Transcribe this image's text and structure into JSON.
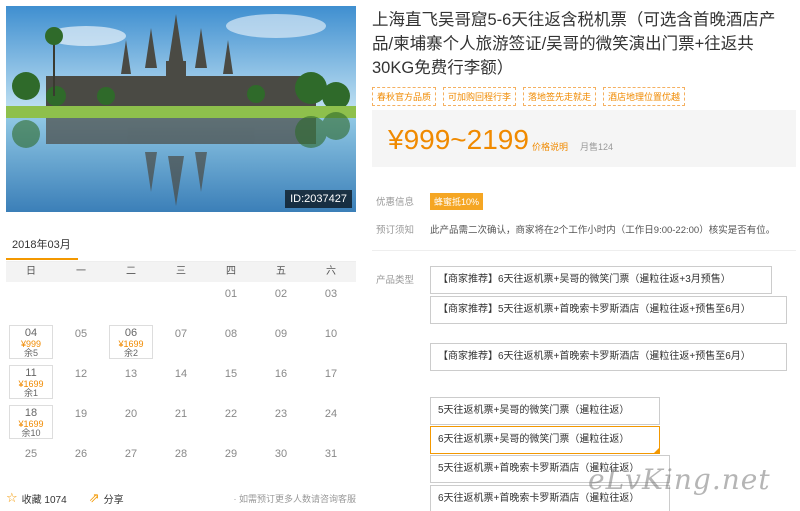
{
  "hero": {
    "id_badge": "ID:2037427"
  },
  "calendar": {
    "month_tab": "2018年03月",
    "weekdays": [
      "日",
      "一",
      "二",
      "三",
      "四",
      "五",
      "六"
    ],
    "days": [
      {
        "d": ""
      },
      {
        "d": ""
      },
      {
        "d": ""
      },
      {
        "d": ""
      },
      {
        "d": "01"
      },
      {
        "d": "02"
      },
      {
        "d": "03"
      },
      {
        "d": "04",
        "price": "¥999",
        "stock": "余5"
      },
      {
        "d": "05"
      },
      {
        "d": "06",
        "price": "¥1699",
        "stock": "余2"
      },
      {
        "d": "07"
      },
      {
        "d": "08"
      },
      {
        "d": "09"
      },
      {
        "d": "10"
      },
      {
        "d": "11",
        "price": "¥1699",
        "stock": "余1"
      },
      {
        "d": "12"
      },
      {
        "d": "13"
      },
      {
        "d": "14"
      },
      {
        "d": "15"
      },
      {
        "d": "16"
      },
      {
        "d": "17"
      },
      {
        "d": "18",
        "price": "¥1699",
        "stock": "余10"
      },
      {
        "d": "19"
      },
      {
        "d": "20"
      },
      {
        "d": "21"
      },
      {
        "d": "22"
      },
      {
        "d": "23"
      },
      {
        "d": "24"
      },
      {
        "d": "25"
      },
      {
        "d": "26"
      },
      {
        "d": "27"
      },
      {
        "d": "28"
      },
      {
        "d": "29"
      },
      {
        "d": "30"
      },
      {
        "d": "31"
      }
    ]
  },
  "bottom": {
    "favorite": "收藏 1074",
    "share": "分享",
    "tip": "· 如需预订更多人数请咨询客服"
  },
  "product": {
    "title": "上海直飞吴哥窟5-6天往返含税机票（可选含首晚酒店产品/柬埔寨个人旅游签证/吴哥的微笑演出门票+往返共30KG免费行李额）",
    "tags": [
      "春秋官方品质",
      "可加购回程行李",
      "落地签先走就走",
      "酒店地理位置优越"
    ],
    "price": "¥999~2199",
    "price_link": "价格说明",
    "sales": "月售124"
  },
  "info": {
    "promo_label": "优惠信息",
    "promo_badge": "蜂蜜抵10%",
    "notice_label": "预订须知",
    "notice_text": "此产品需二次确认，商家将在2个工作小时内（工作日9:00-22:00）核实是否有位。",
    "type_label": "产品类型"
  },
  "options": [
    "【商家推荐】6天往返机票+吴哥的微笑门票（暹粒往返+3月预售）",
    "【商家推荐】5天往返机票+首晚索卡罗斯酒店（暹粒往返+预售至6月）",
    "【商家推荐】6天往返机票+首晚索卡罗斯酒店（暹粒往返+预售至6月）",
    "5天往返机票+吴哥的微笑门票（暹粒往返）",
    "6天往返机票+吴哥的微笑门票（暹粒往返）",
    "5天往返机票+首晚索卡罗斯酒店（暹粒往返）",
    "6天往返机票+首晚索卡罗斯酒店（暹粒往返）"
  ],
  "watermark": "eLvKing.net",
  "colors": {
    "accent": "#f39800",
    "price": "#f08a00"
  }
}
